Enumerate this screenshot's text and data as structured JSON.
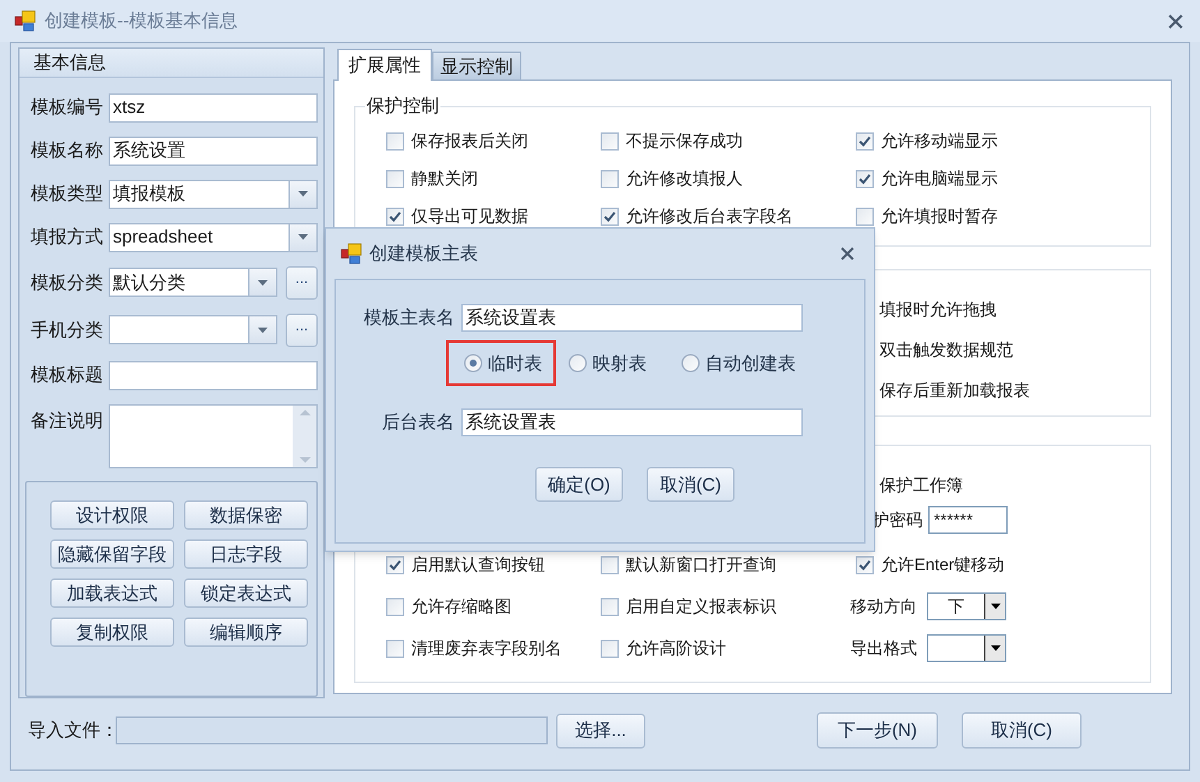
{
  "window": {
    "title": "创建模板--模板基本信息"
  },
  "basic_info": {
    "title": "基本信息",
    "fields": [
      {
        "label": "模板编号",
        "kind": "text",
        "value": "xtsz"
      },
      {
        "label": "模板名称",
        "kind": "text",
        "value": "系统设置"
      },
      {
        "label": "模板类型",
        "kind": "dropdown",
        "value": "填报模板"
      },
      {
        "label": "填报方式",
        "kind": "dropdown",
        "value": "spreadsheet"
      },
      {
        "label": "模板分类",
        "kind": "dropdown_more",
        "value": "默认分类",
        "more": "..."
      },
      {
        "label": "手机分类",
        "kind": "dropdown_more",
        "more": "..."
      },
      {
        "label": "模板标题",
        "kind": "text"
      },
      {
        "label": "备注说明",
        "kind": "memo"
      }
    ],
    "buttons": [
      "设计权限",
      "数据保密",
      "隐藏保留字段",
      "日志字段",
      "加载表达式",
      "锁定表达式",
      "复制权限",
      "编辑顺序"
    ]
  },
  "tabs": [
    {
      "label": "扩展属性",
      "selected": true
    },
    {
      "label": "显示控制",
      "selected": false
    }
  ],
  "protection": {
    "title": "保护控制",
    "options": [
      {
        "label": "保存报表后关闭",
        "checked": false
      },
      {
        "label": "不提示保存成功",
        "checked": false
      },
      {
        "label": "允许移动端显示",
        "checked": true
      },
      {
        "label": "静默关闭",
        "checked": false
      },
      {
        "label": "允许修改填报人",
        "checked": false
      },
      {
        "label": "允许电脑端显示",
        "checked": true
      },
      {
        "label": "仅导出可见数据",
        "checked": true
      },
      {
        "label": "允许修改后台表字段名",
        "checked": true
      },
      {
        "label": "允许填报时暂存",
        "checked": false
      }
    ]
  },
  "group_2": {
    "items": [
      "填报时允许拖拽",
      "双击触发数据规范",
      "保存后重新加载报表"
    ]
  },
  "group_3": {
    "top_items": [
      {
        "kind": "text",
        "label": "保护工作簿"
      },
      {
        "kind": "password",
        "label": "护密码",
        "value": "******"
      }
    ],
    "grid": [
      {
        "kind": "checkbox",
        "label": "启用默认查询按钮",
        "checked": true
      },
      {
        "kind": "checkbox",
        "label": "默认新窗口打开查询",
        "checked": false
      },
      {
        "kind": "checkbox",
        "label": "允许Enter键移动",
        "checked": true
      },
      {
        "kind": "checkbox",
        "label": "允许存缩略图",
        "checked": false
      },
      {
        "kind": "checkbox",
        "label": "启用自定义报表标识",
        "checked": false
      },
      {
        "kind": "dropdown",
        "label": "移动方向",
        "value": "下"
      },
      {
        "kind": "checkbox",
        "label": "清理废弃表字段别名",
        "checked": false
      },
      {
        "kind": "checkbox",
        "label": "允许高阶设计",
        "checked": false
      },
      {
        "kind": "dropdown",
        "label": "导出格式"
      }
    ]
  },
  "bottom": {
    "import_label": "导入文件：",
    "choose_button": "选择...",
    "next_button": "下一步(N)",
    "cancel_button": "取消(C)"
  },
  "dialog": {
    "title": "创建模板主表",
    "main_table_label": "模板主表名",
    "main_table_value": "系统设置表",
    "table_types": [
      {
        "label": "临时表",
        "selected": true,
        "highlighted": true
      },
      {
        "label": "映射表",
        "selected": false,
        "highlighted": false
      },
      {
        "label": "自动创建表",
        "selected": false,
        "highlighted": false
      }
    ],
    "backend_label": "后台表名",
    "backend_value": "系统设置表",
    "buttons": [
      "确定(O)",
      "取消(C)"
    ]
  }
}
